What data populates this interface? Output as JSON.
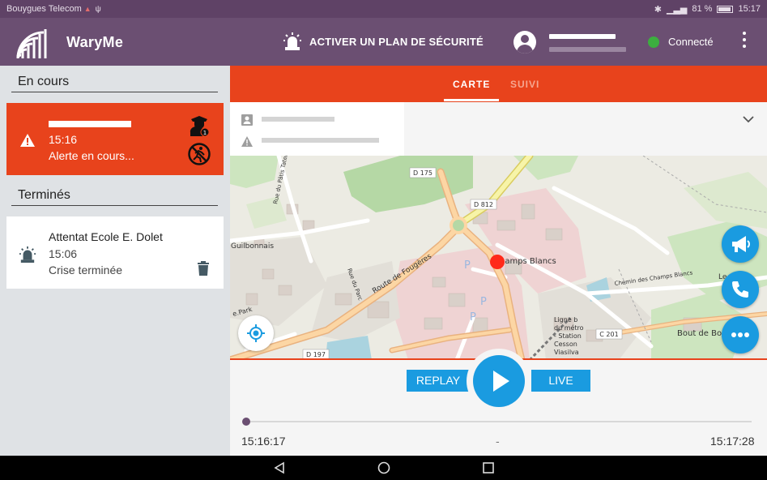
{
  "status_bar": {
    "carrier": "Bouygues Telecom",
    "battery": "81 %",
    "time": "15:17"
  },
  "app_bar": {
    "title": "WaryMe",
    "plan_button": "ACTIVER UN PLAN DE SÉCURITÉ",
    "connection_status": "Connecté",
    "colors": {
      "primary": "#6b4f72",
      "connected": "#3cae3f"
    }
  },
  "sidebar": {
    "current_section": "En cours",
    "finished_section": "Terminés",
    "current_items": [
      {
        "time": "15:16",
        "status": "Alerte en cours..."
      }
    ],
    "finished_items": [
      {
        "title": "Attentat Ecole E. Dolet",
        "time": "15:06",
        "status": "Crise terminée"
      }
    ]
  },
  "tabs": [
    {
      "label": "CARTE",
      "active": true
    },
    {
      "label": "SUIVI",
      "active": false
    }
  ],
  "map": {
    "labels": {
      "d175": "D 175",
      "d812": "D 812",
      "d197": "D 197",
      "c201": "C 201",
      "route_fougeres": "Route de Fougères",
      "champs_blancs": "Champs Blancs",
      "guilbonnais": "Guilbonnais",
      "rue_paris": "Rue du Pâtis Tatelin",
      "rue_parc": "Rue du Parc",
      "park": "e.Park",
      "chemin": "Chemin des Champs Blancs",
      "bout_de_bois": "Bout de Bo",
      "le": "Le",
      "ligne_b": "Ligne b",
      "metro": "du métro",
      "station": "- Station",
      "cesson": "Cesson",
      "viasilva": "Viasilva"
    },
    "accent_red": "#e8431c",
    "marker_color": "#ff2a1a"
  },
  "playback": {
    "replay_label": "REPLAY",
    "live_label": "LIVE",
    "start_time": "15:16:17",
    "middle": "-",
    "end_time": "15:17:28",
    "progress": 0
  },
  "icons": {
    "logo": "wifi-signal-logo",
    "plan": "siren-icon",
    "alert": "warning-icon",
    "police": "police-officer-icon",
    "runner": "no-running-icon",
    "trash": "trash-icon",
    "locate": "gps-target-icon",
    "megaphone": "megaphone-icon",
    "phone": "phone-icon",
    "more": "more-horiz-icon"
  }
}
